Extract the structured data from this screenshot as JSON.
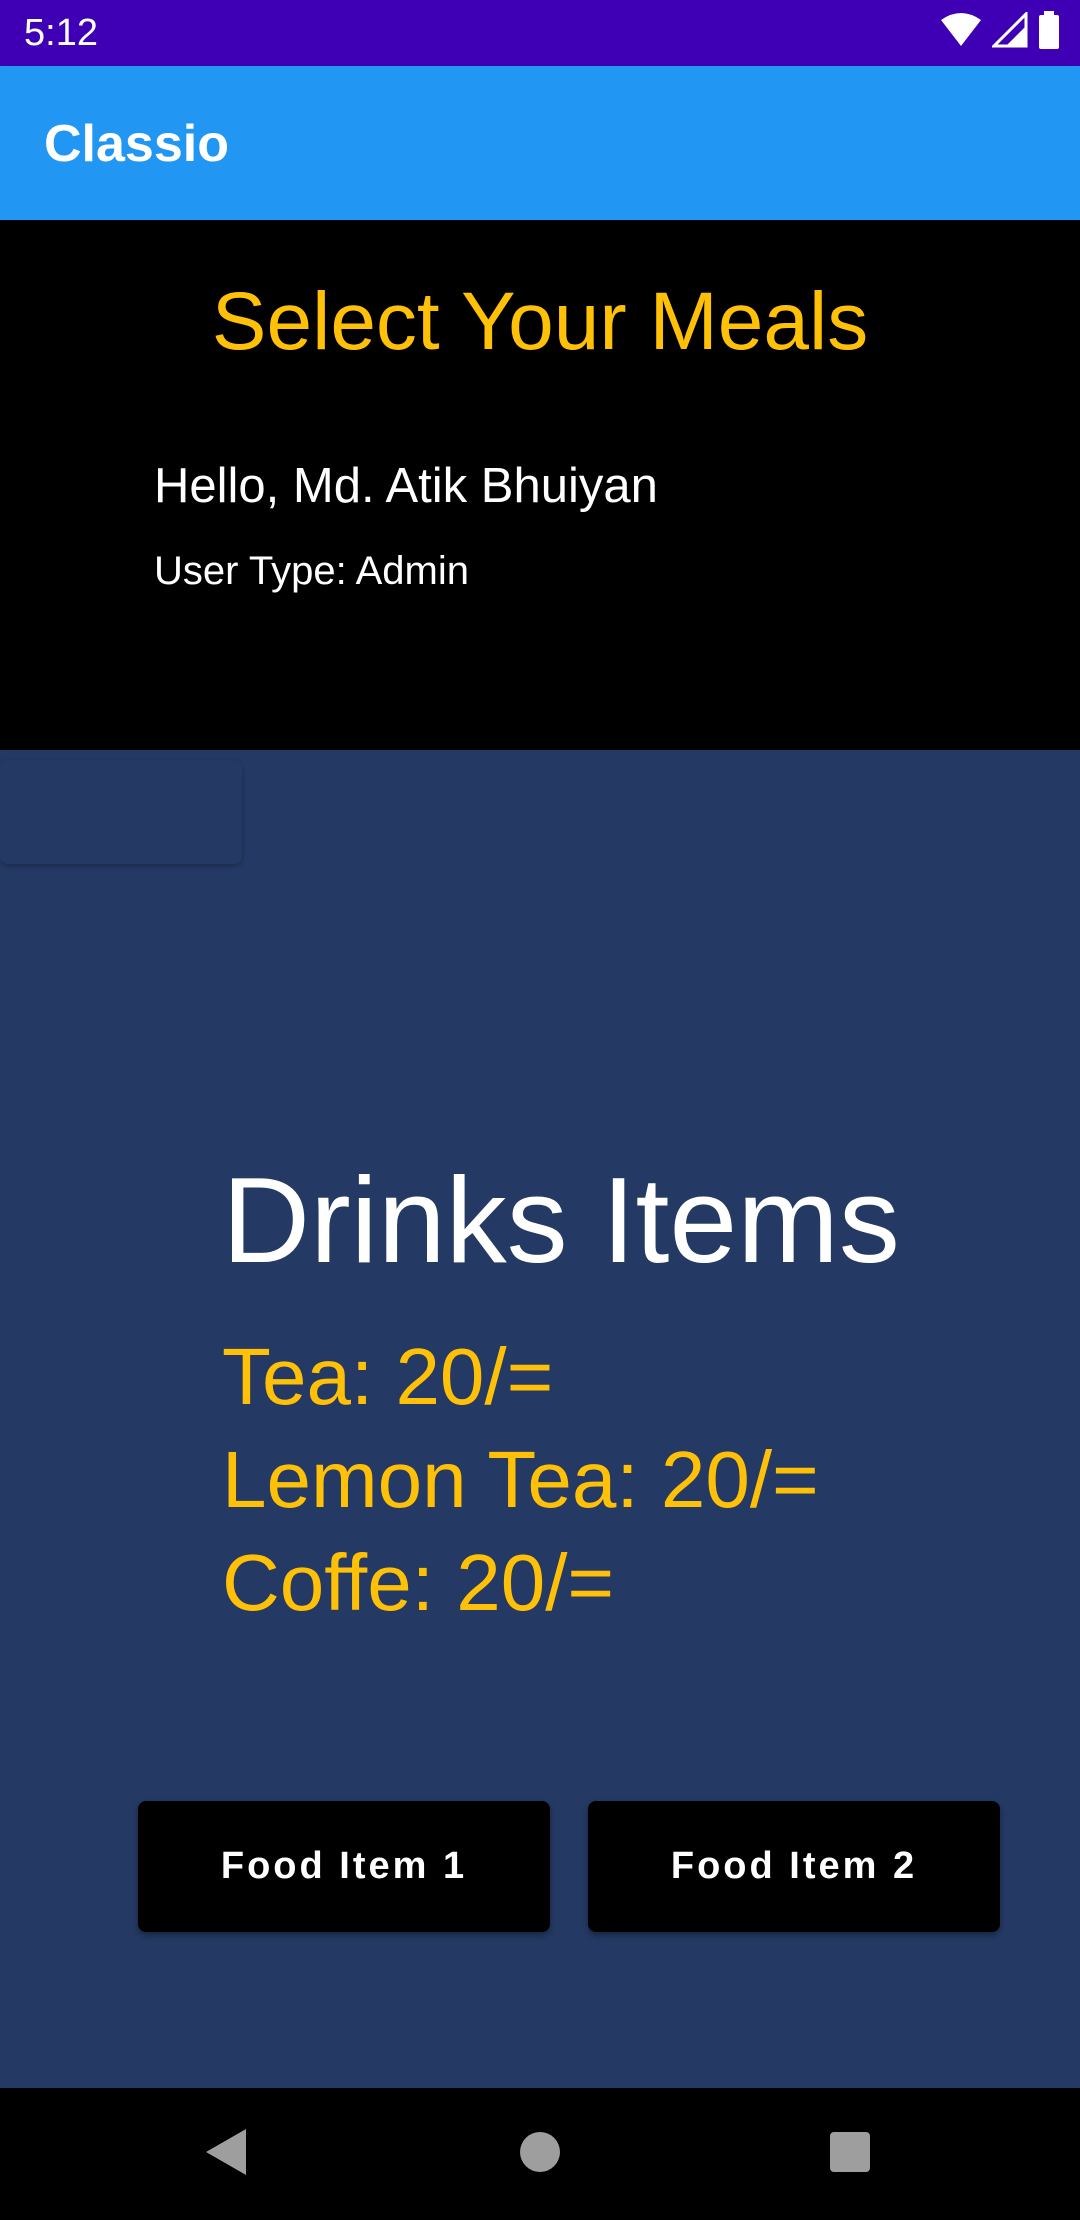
{
  "status_bar": {
    "time": "5:12",
    "icons": [
      "wifi-icon",
      "signal-icon",
      "battery-icon"
    ]
  },
  "app_bar": {
    "title": "Classio"
  },
  "header": {
    "title": "Select Your Meals",
    "greeting": "Hello, Md. Atik Bhuiyan",
    "user_type": "User Type: Admin"
  },
  "menu": {
    "section_title": "Drinks Items",
    "items": [
      "Tea: 20/=",
      "Lemon Tea: 20/=",
      "Coffe: 20/="
    ]
  },
  "buttons": {
    "food_item_1": "Food Item 1",
    "food_item_2": "Food Item 2"
  },
  "nav_bar": {
    "icons": [
      "back-icon",
      "home-icon",
      "recents-icon"
    ]
  },
  "colors": {
    "status_bar": "#3F00B5",
    "app_bar": "#2196F3",
    "header_bg": "#000000",
    "content_bg": "#243963",
    "accent_text": "#FFC107",
    "primary_text": "#FFFFFF",
    "button_bg": "#000000"
  }
}
